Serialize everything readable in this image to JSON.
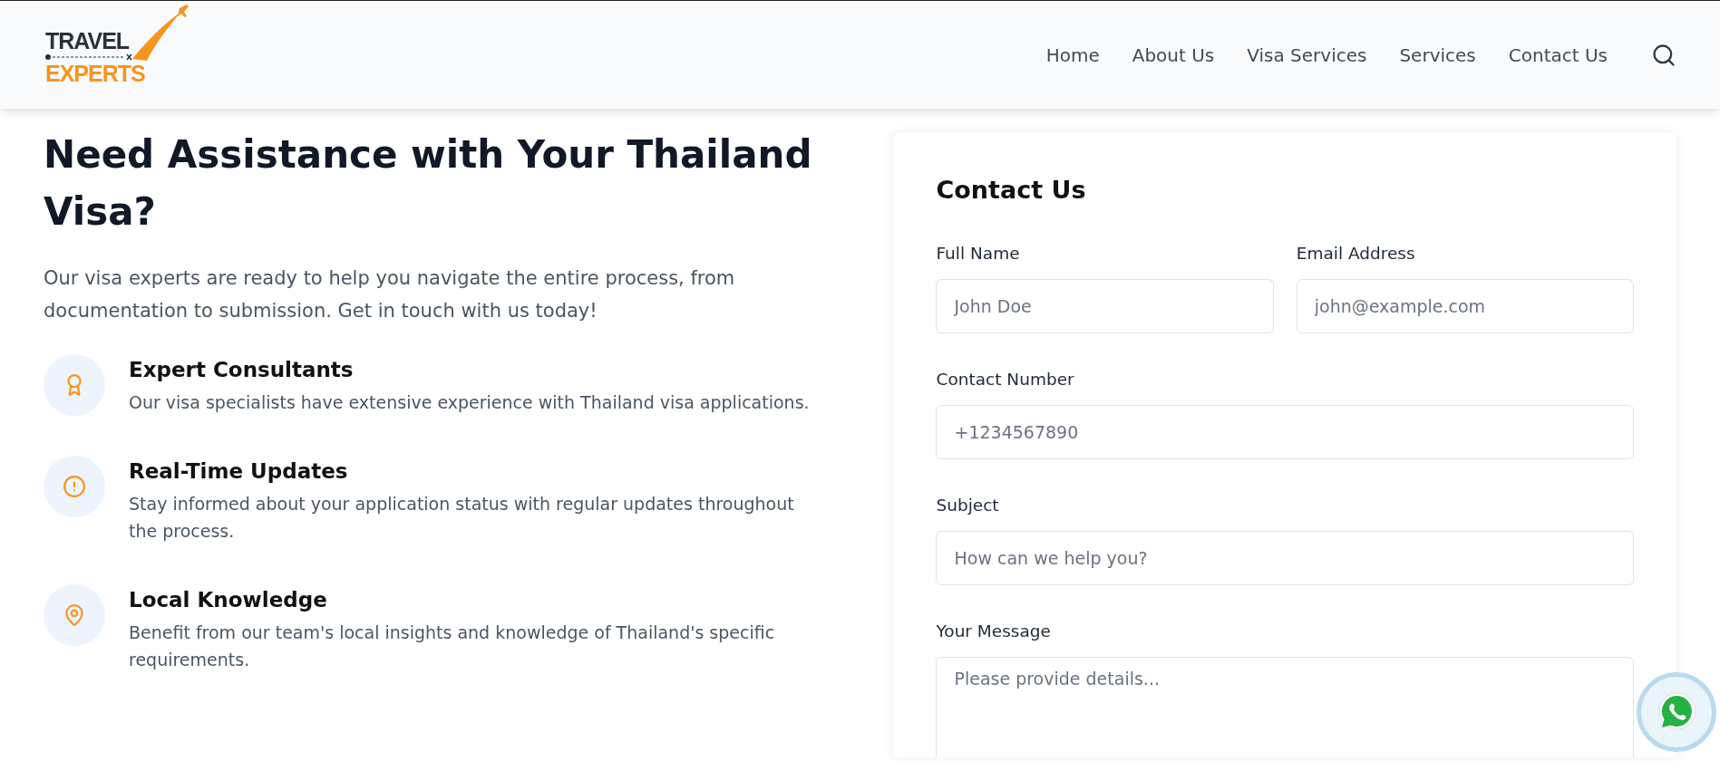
{
  "logo": {
    "top": "TRAVEL",
    "bottom": "EXPERTS"
  },
  "nav": [
    {
      "label": "Home"
    },
    {
      "label": "About Us"
    },
    {
      "label": "Visa Services"
    },
    {
      "label": "Services"
    },
    {
      "label": "Contact Us"
    }
  ],
  "hero": {
    "title": "Need Assistance with Your Thailand Visa?",
    "intro": "Our visa experts are ready to help you navigate the entire process, from documentation to submission. Get in touch with us today!"
  },
  "features": [
    {
      "kind": "award",
      "title": "Expert Consultants",
      "text": "Our visa specialists have extensive experience with Thailand visa applications."
    },
    {
      "kind": "alert",
      "title": "Real-Time Updates",
      "text": "Stay informed about your application status with regular updates throughout the process."
    },
    {
      "kind": "pin",
      "title": "Local Knowledge",
      "text": "Benefit from our team's local insights and knowledge of Thailand's specific requirements."
    }
  ],
  "form": {
    "title": "Contact Us",
    "rows": [
      [
        {
          "kind": "input",
          "label": "Full Name",
          "placeholder": "John Doe"
        },
        {
          "kind": "input",
          "label": "Email Address",
          "placeholder": "john@example.com"
        }
      ],
      [
        {
          "kind": "input",
          "label": "Contact Number",
          "placeholder": "+1234567890"
        }
      ],
      [
        {
          "kind": "input",
          "label": "Subject",
          "placeholder": "How can we help you?"
        }
      ],
      [
        {
          "kind": "textarea",
          "label": "Your Message",
          "placeholder": "Please provide details..."
        }
      ]
    ]
  }
}
